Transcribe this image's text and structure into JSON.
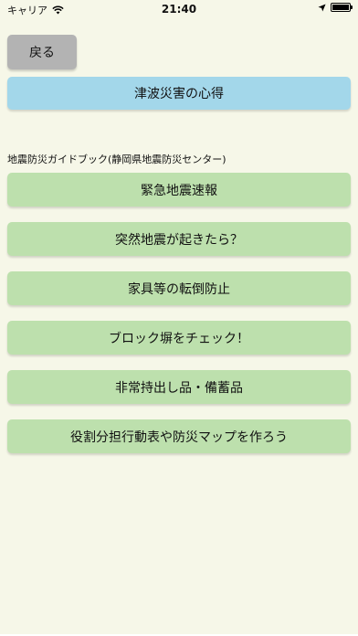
{
  "status_bar": {
    "carrier": "キャリア",
    "time": "21:40"
  },
  "back_button": {
    "label": "戻る"
  },
  "tsunami_button": {
    "label": "津波災害の心得"
  },
  "section": {
    "title": "地震防災ガイドブック(静岡県地震防災センター)"
  },
  "menu": {
    "items": [
      {
        "label": "緊急地震速報"
      },
      {
        "label": "突然地震が起きたら？"
      },
      {
        "label": "家具等の転倒防止"
      },
      {
        "label": "ブロック塀をチェック！"
      },
      {
        "label": "非常持出し品・備蓄品"
      },
      {
        "label": "役割分担行動表や防災マップを作ろう"
      }
    ]
  },
  "colors": {
    "background": "#f6f7e8",
    "back_button": "#b3b3b3",
    "tsunami_button": "#a3d7ea",
    "menu_button": "#bde0ad"
  }
}
